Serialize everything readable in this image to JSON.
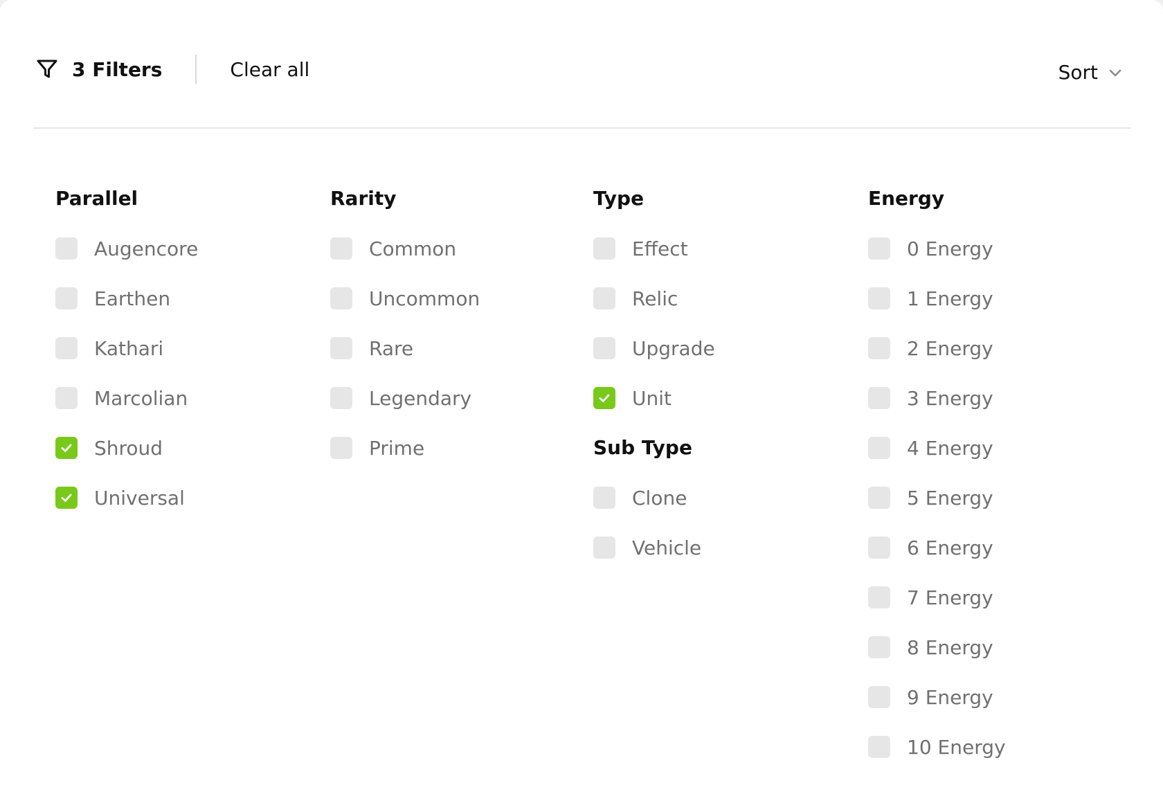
{
  "header": {
    "filter_icon": "filter-funnel-icon",
    "filter_count_label": "3 Filters",
    "clear_all_label": "Clear all",
    "sort_label": "Sort",
    "sort_icon": "chevron-down-icon"
  },
  "colors": {
    "checked": "#78c91a",
    "unchecked": "#e6e6e6",
    "heading": "#111111",
    "option_text": "#707070"
  },
  "groups": {
    "parallel": {
      "title": "Parallel",
      "options": [
        {
          "label": "Augencore",
          "checked": false
        },
        {
          "label": "Earthen",
          "checked": false
        },
        {
          "label": "Kathari",
          "checked": false
        },
        {
          "label": "Marcolian",
          "checked": false
        },
        {
          "label": "Shroud",
          "checked": true
        },
        {
          "label": "Universal",
          "checked": true
        }
      ]
    },
    "rarity": {
      "title": "Rarity",
      "options": [
        {
          "label": "Common",
          "checked": false
        },
        {
          "label": "Uncommon",
          "checked": false
        },
        {
          "label": "Rare",
          "checked": false
        },
        {
          "label": "Legendary",
          "checked": false
        },
        {
          "label": "Prime",
          "checked": false
        }
      ]
    },
    "type": {
      "title": "Type",
      "options": [
        {
          "label": "Effect",
          "checked": false
        },
        {
          "label": "Relic",
          "checked": false
        },
        {
          "label": "Upgrade",
          "checked": false
        },
        {
          "label": "Unit",
          "checked": true
        }
      ]
    },
    "sub_type": {
      "title": "Sub Type",
      "options": [
        {
          "label": "Clone",
          "checked": false
        },
        {
          "label": "Vehicle",
          "checked": false
        }
      ]
    },
    "energy": {
      "title": "Energy",
      "options": [
        {
          "label": "0 Energy",
          "checked": false
        },
        {
          "label": "1 Energy",
          "checked": false
        },
        {
          "label": "2 Energy",
          "checked": false
        },
        {
          "label": "3 Energy",
          "checked": false
        },
        {
          "label": "4 Energy",
          "checked": false
        },
        {
          "label": "5 Energy",
          "checked": false
        },
        {
          "label": "6 Energy",
          "checked": false
        },
        {
          "label": "7 Energy",
          "checked": false
        },
        {
          "label": "8 Energy",
          "checked": false
        },
        {
          "label": "9 Energy",
          "checked": false
        },
        {
          "label": "10 Energy",
          "checked": false
        }
      ]
    }
  }
}
